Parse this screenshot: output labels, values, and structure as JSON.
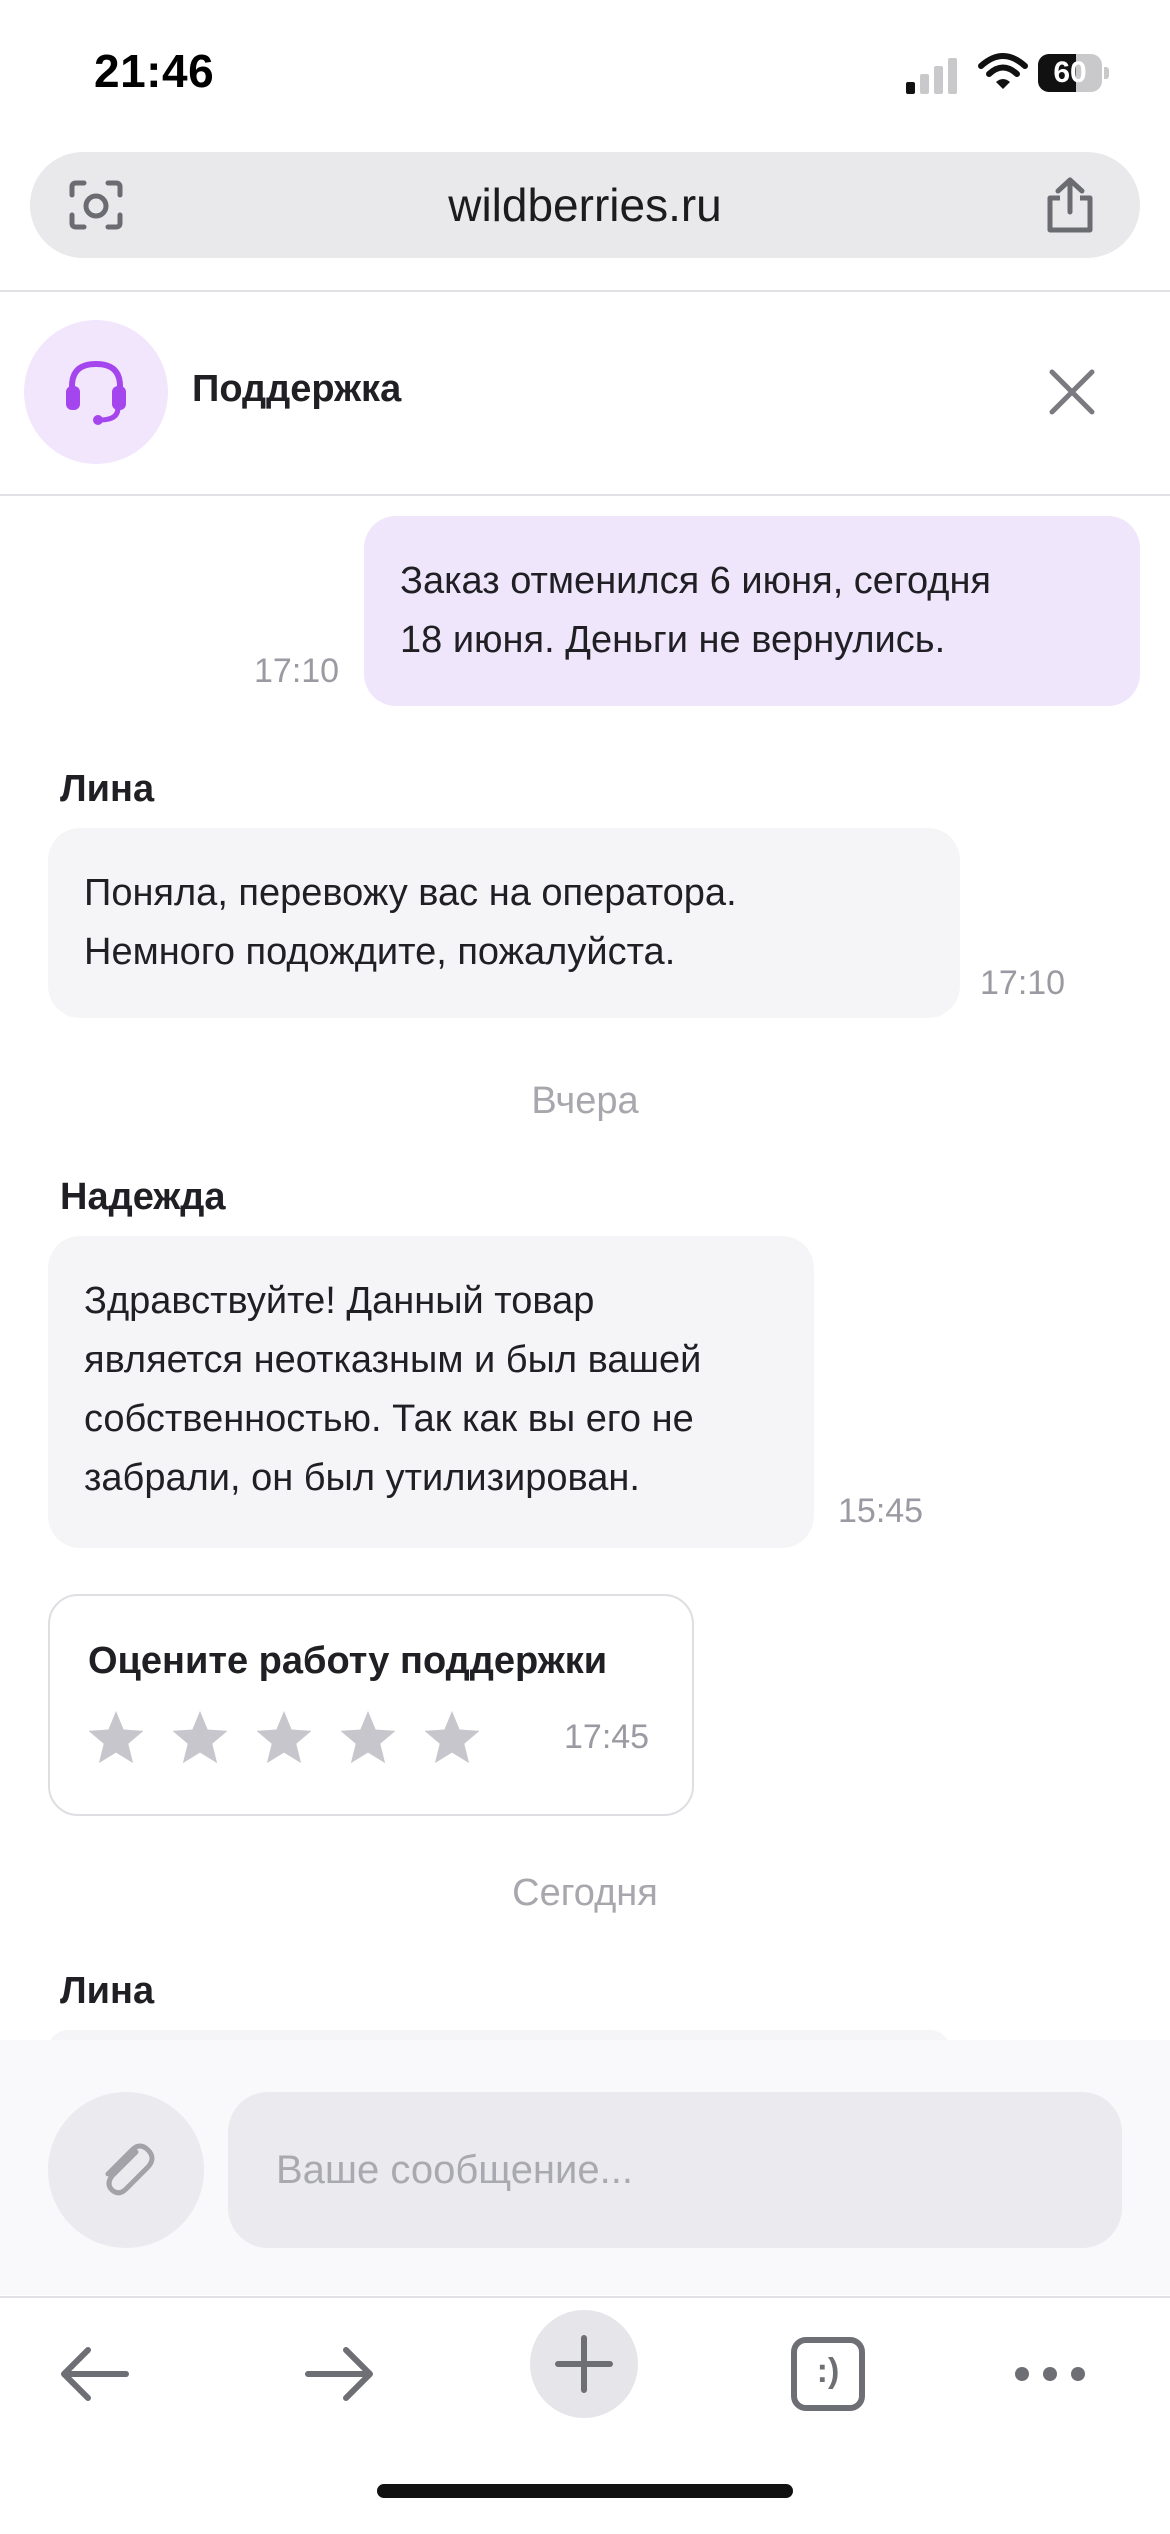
{
  "status_bar": {
    "time": "21:46",
    "battery": "60",
    "battery_level": 0.6
  },
  "browser": {
    "url": "wildberries.ru"
  },
  "chat": {
    "title": "Поддержка",
    "messages": [
      {
        "side": "out",
        "lines": [
          "Заказ отменился 6 июня, сегодня",
          "18 июня. Деньги не вернулись."
        ],
        "time": "17:10"
      },
      {
        "sender": "Лина",
        "side": "in",
        "lines": [
          "Поняла, перевожу вас на оператора.",
          "Немного подождите, пожалуйста."
        ],
        "time": "17:10"
      }
    ],
    "day_separator_1": "Вчера",
    "message_3": {
      "sender": "Надежда",
      "lines": [
        "Здравствуйте! Данный товар",
        "является неотказным и был вашей",
        "собственностью. Так как вы его не",
        "забрали, он был утилизирован."
      ],
      "time": "15:45"
    },
    "rating": {
      "title": "Оцените работу поддержки",
      "time": "17:45",
      "stars": 5,
      "selected": 0
    },
    "day_separator_2": "Сегодня",
    "next_sender": "Лина"
  },
  "composer": {
    "placeholder": "Ваше сообщение..."
  },
  "toolbar": {
    "tabs_label": ":)"
  },
  "colors": {
    "accent": "#a445ed",
    "bubble_out": "#efe6fb",
    "bubble_in": "#f5f5f7"
  },
  "icons": [
    "camera-lens-icon",
    "share-icon",
    "headset-icon",
    "close-icon",
    "star-icon",
    "paperclip-icon",
    "back-arrow-icon",
    "forward-arrow-icon",
    "plus-icon",
    "tabs-icon",
    "more-icon"
  ]
}
